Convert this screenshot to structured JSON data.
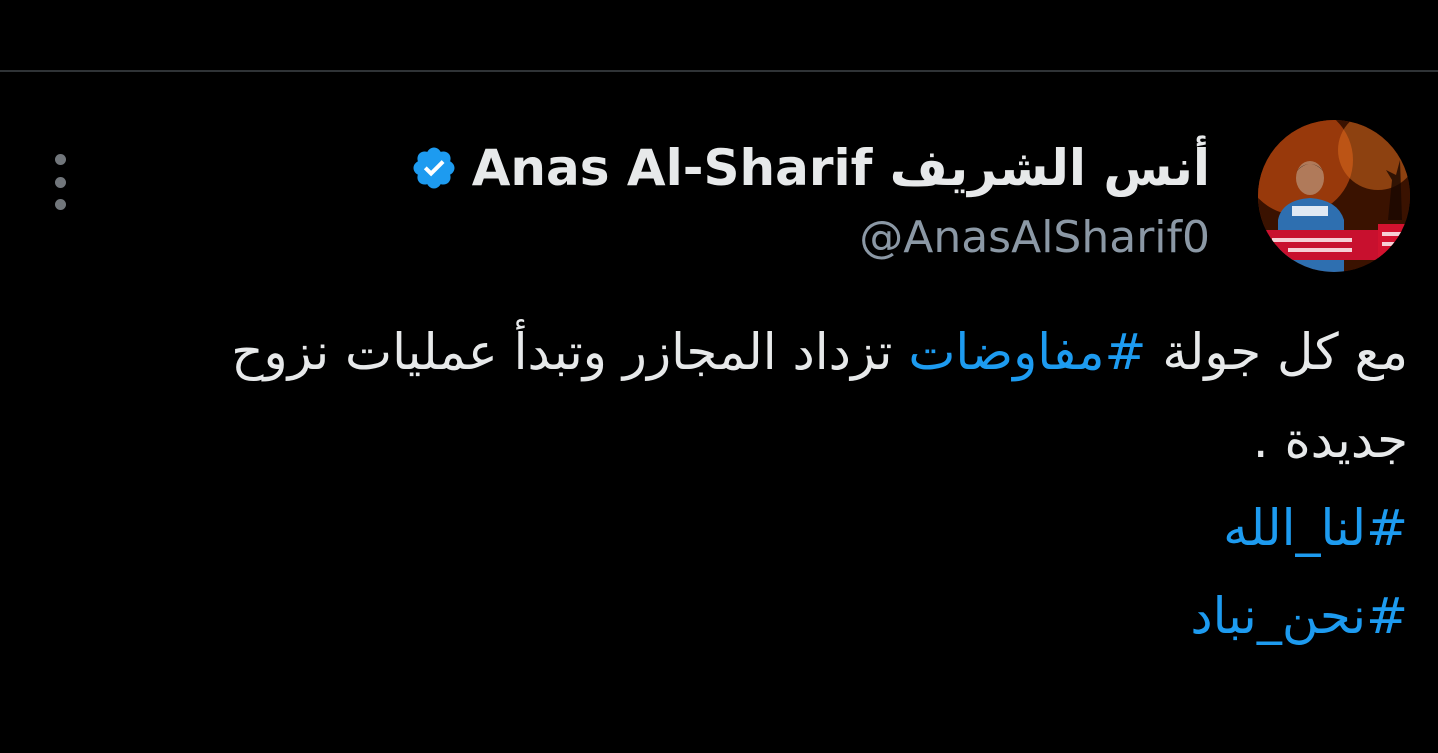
{
  "tweet": {
    "author": {
      "display_name": "Anas Al-Sharif أنس الشريف",
      "handle": "@AnasAlSharif0",
      "verified": true,
      "verified_icon": "verified-badge-icon",
      "verified_color": "#1d9bf0"
    },
    "more_icon": "more-vertical-icon",
    "text": {
      "part1": "مع كل جولة ",
      "hashtag1": "#مفاوضات",
      "part2": " تزداد المجازر وتبدأ عمليات نزوح جديدة .",
      "hashtag2": "#لنا_الله",
      "hashtag3": "#نحن_نباد"
    },
    "link_color": "#1d9bf0"
  }
}
